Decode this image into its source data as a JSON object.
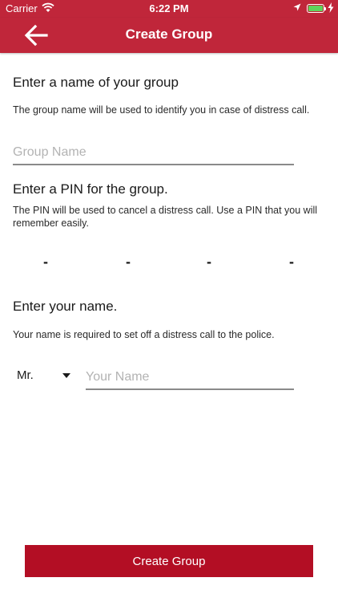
{
  "status_bar": {
    "carrier": "Carrier",
    "time": "6:22 PM",
    "battery_color": "#5fd35a",
    "icons": [
      "wifi-icon",
      "location-arrow-icon",
      "battery-icon",
      "charging-bolt-icon"
    ]
  },
  "nav": {
    "title": "Create Group",
    "back_icon": "arrow-left-icon",
    "bar_color": "#c0263a"
  },
  "group_section": {
    "heading": "Enter a name of your group",
    "description": "The group name will be used to identify you in case of distress call.",
    "input_placeholder": "Group Name",
    "input_value": ""
  },
  "pin_section": {
    "heading": "Enter a PIN for the group.",
    "description": "The PIN will be used to cancel a distress call. Use a PIN that you will remember easily.",
    "digits": [
      "-",
      "-",
      "-",
      "-"
    ]
  },
  "name_section": {
    "heading": "Enter your name.",
    "description": "Your name is required to set off a distress call to the police.",
    "title_selected": "Mr.",
    "input_placeholder": "Your Name",
    "input_value": ""
  },
  "submit": {
    "label": "Create Group",
    "color": "#b30e24"
  }
}
